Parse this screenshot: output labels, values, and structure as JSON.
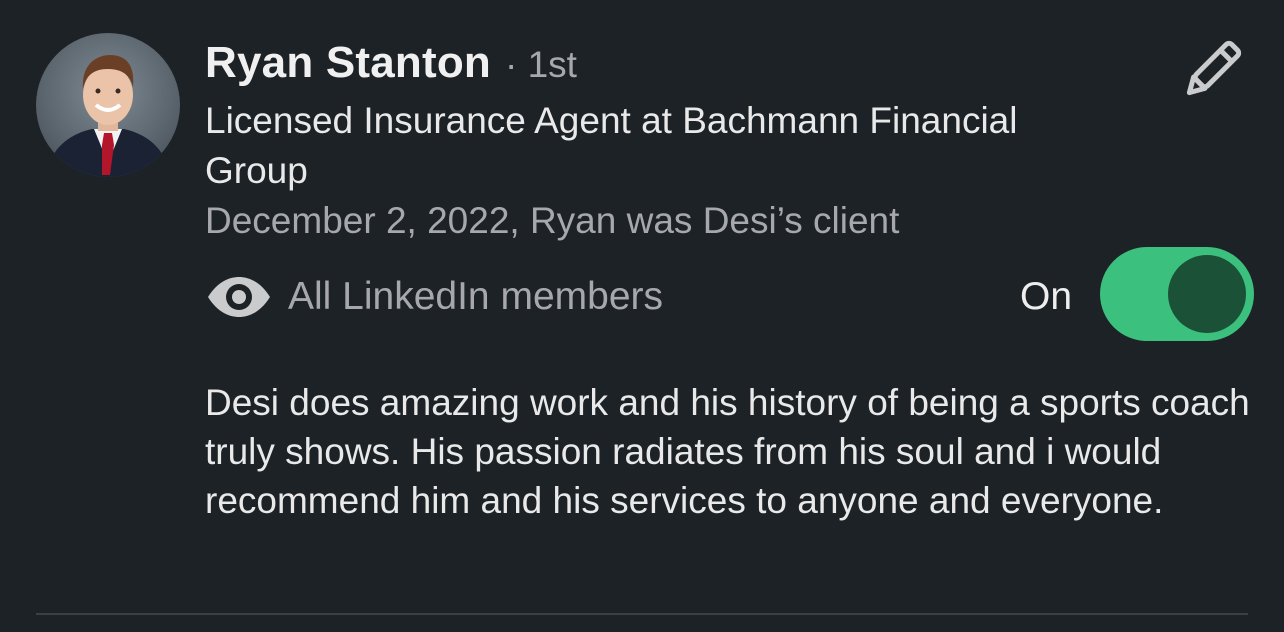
{
  "recommendation": {
    "author_name": "Ryan Stanton",
    "connection_degree": "· 1st",
    "headline": "Licensed Insurance Agent at Bachmann Financial Group",
    "relationship": "December 2, 2022, Ryan was Desi’s client",
    "visibility": {
      "icon": "eye-icon",
      "label": "All LinkedIn members"
    },
    "toggle": {
      "label": "On",
      "state": "on",
      "color": "#3cc07e"
    },
    "text": "Desi does amazing work and his history of being a sports coach truly shows. His passion radiates from his soul and i would recommend him and his services to anyone and everyone.",
    "edit_icon": "pencil-icon"
  }
}
